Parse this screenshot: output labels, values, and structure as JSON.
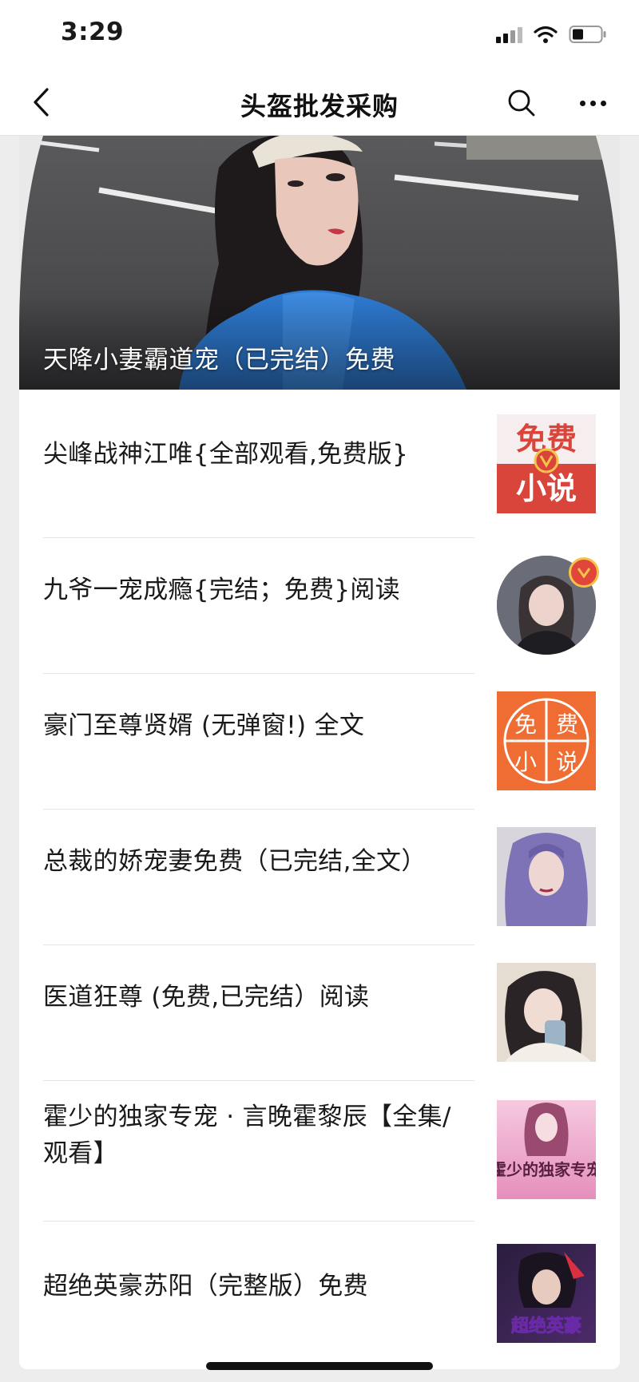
{
  "status_bar": {
    "time": "3:29"
  },
  "nav": {
    "title": "头盔批发采购"
  },
  "cover": {
    "title": "天降小妻霸道宠（已完结）免费"
  },
  "articles": [
    {
      "title": "尖峰战神江唯{全部观看,免费版}",
      "thumb": "free-novel-red-thumbnail",
      "thumb_text_top": "免费",
      "thumb_text_bottom": "小说"
    },
    {
      "title": "九爷一宠成瘾{完结；免费}阅读",
      "thumb": "girl-avatar-round-thumbnail"
    },
    {
      "title": "豪门至尊贤婿 (无弹窗!) 全文",
      "thumb": "free-novel-orange-thumbnail",
      "thumb_chars": [
        "免",
        "费",
        "小",
        "说"
      ]
    },
    {
      "title": "总裁的娇宠妻免费（已完结,全文）",
      "thumb": "purple-hair-girl-thumbnail"
    },
    {
      "title": "医道狂尊 (免费,已完结）阅读",
      "thumb": "girl-photo-thumbnail"
    },
    {
      "title": "霍少的独家专宠 · 言晚霍黎辰【全集/观看】",
      "thumb": "novel-cover-pink-thumbnail",
      "thumb_text": "霍少的独家专宠"
    },
    {
      "title": "超绝英豪苏阳（完整版）免费",
      "thumb": "anime-hero-cover-thumbnail",
      "thumb_text": "超绝英豪"
    }
  ],
  "colors": {
    "red_thumb": "#d9453b",
    "orange_thumb": "#ef6d33",
    "verified_badge": "#e0463a"
  }
}
